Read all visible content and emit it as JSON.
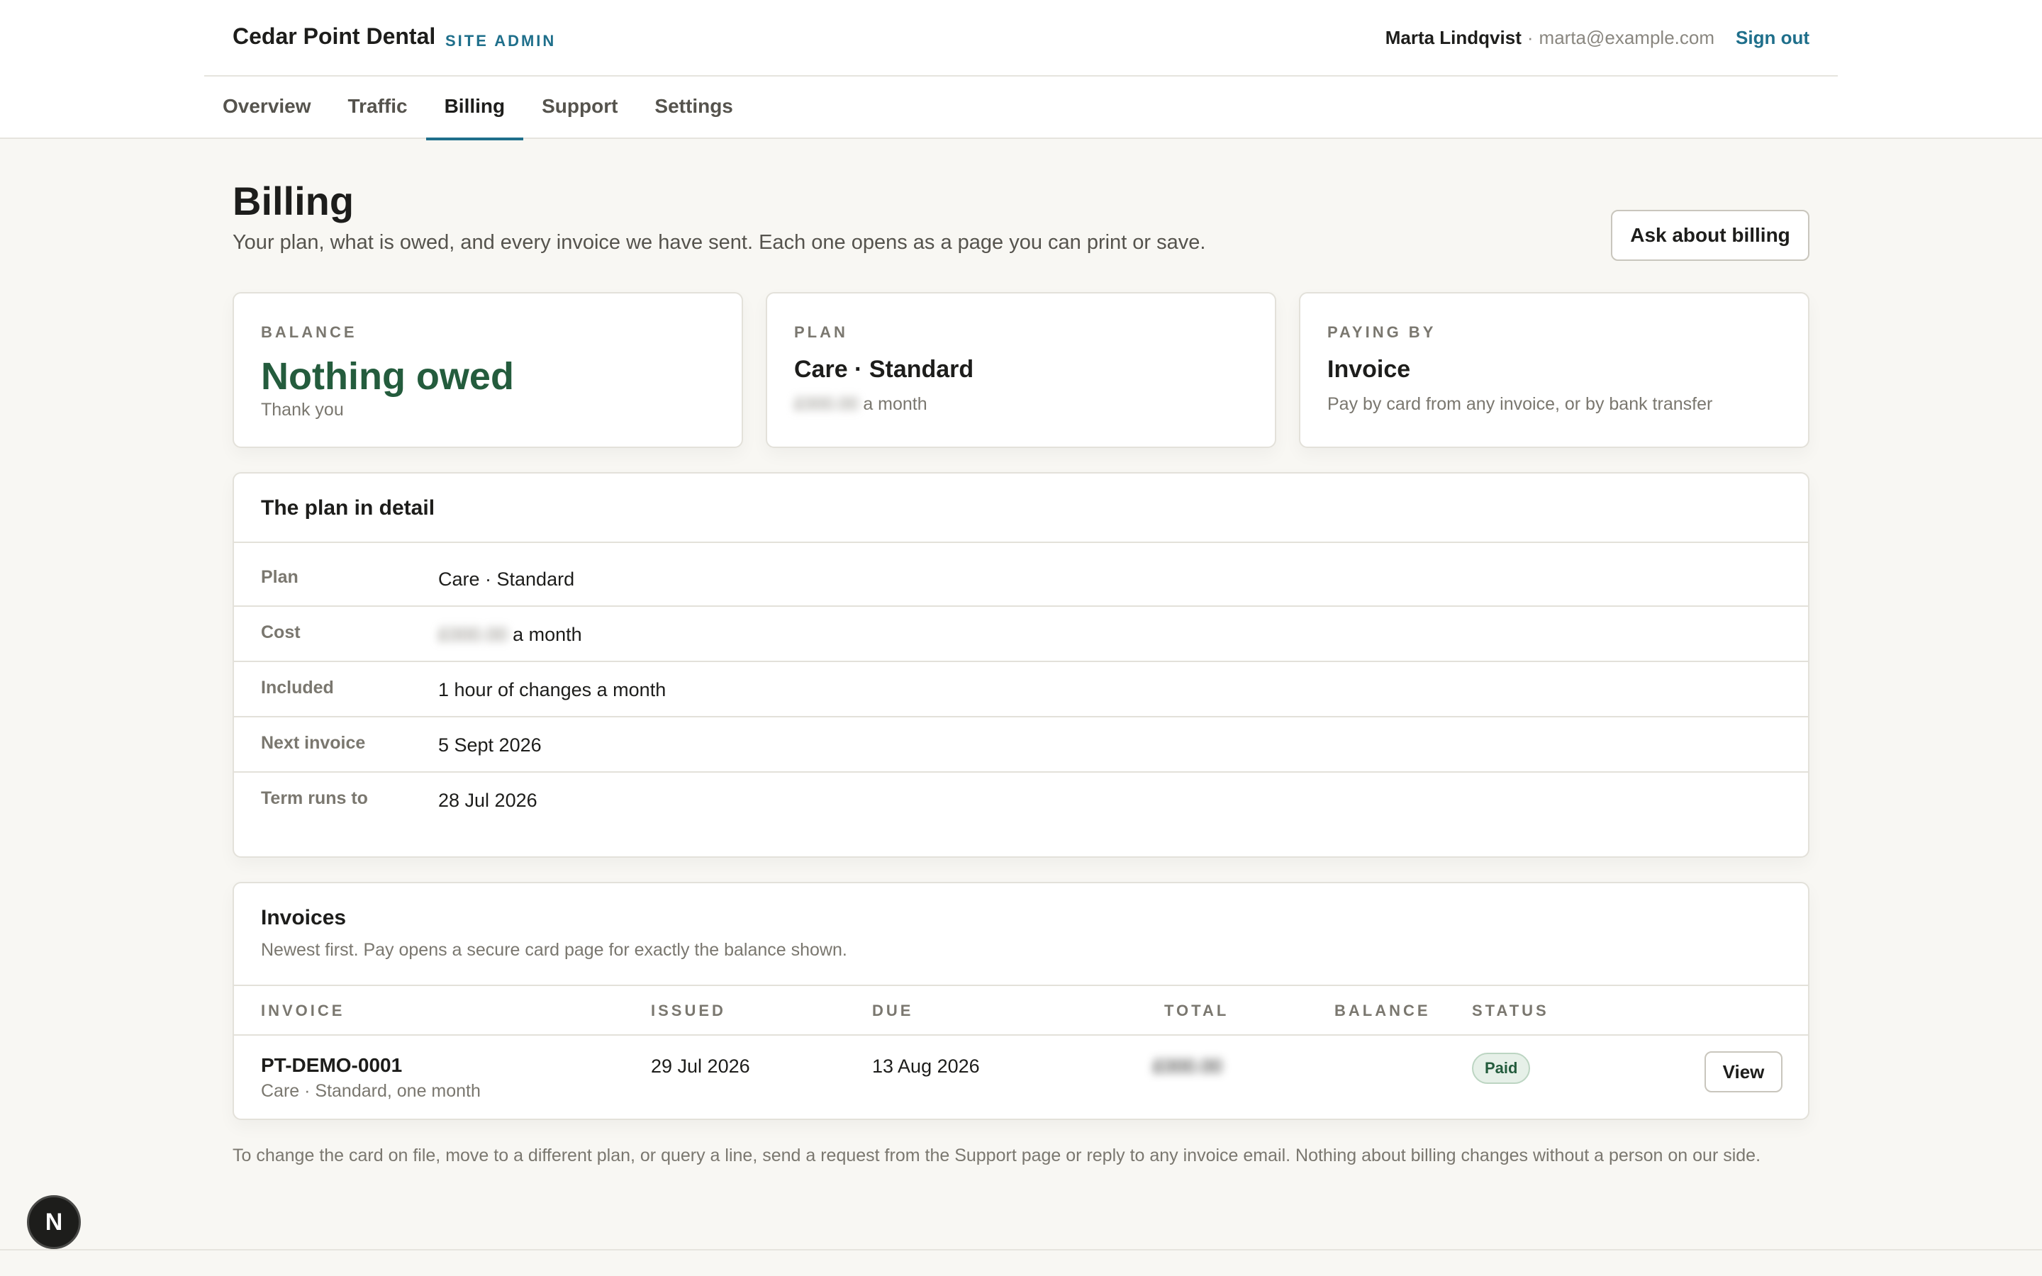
{
  "header": {
    "brand": "Cedar Point Dental",
    "brand_tag": "SITE ADMIN",
    "user_name": "Marta Lindqvist",
    "user_sep": "·",
    "user_email": "marta@example.com",
    "sign_out": "Sign out"
  },
  "tabs": [
    {
      "label": "Overview"
    },
    {
      "label": "Traffic"
    },
    {
      "label": "Billing",
      "active": true
    },
    {
      "label": "Support"
    },
    {
      "label": "Settings"
    }
  ],
  "page": {
    "title": "Billing",
    "subtitle": "Your plan, what is owed, and every invoice we have sent. Each one opens as a page you can print or save.",
    "ask_button": "Ask about billing"
  },
  "summary": {
    "balance": {
      "label": "BALANCE",
      "value": "Nothing owed",
      "note": "Thank you"
    },
    "plan": {
      "label": "PLAN",
      "value": "Care · Standard",
      "amount": "£000.00",
      "period": "a month"
    },
    "paying": {
      "label": "PAYING BY",
      "value": "Invoice",
      "note": "Pay by card from any invoice, or by bank transfer"
    }
  },
  "plan_detail": {
    "title": "The plan in detail",
    "rows": [
      {
        "label": "Plan",
        "value": "Care · Standard"
      },
      {
        "label": "Cost",
        "amount": "£000.00",
        "value": "a month"
      },
      {
        "label": "Included",
        "value": "1 hour of changes a month"
      },
      {
        "label": "Next invoice",
        "value": "5 Sept 2026"
      },
      {
        "label": "Term runs to",
        "value": "28 Jul 2026"
      }
    ]
  },
  "invoices": {
    "title": "Invoices",
    "subtitle": "Newest first. Pay opens a secure card page for exactly the balance shown.",
    "columns": [
      "INVOICE",
      "ISSUED",
      "DUE",
      "TOTAL",
      "BALANCE",
      "STATUS"
    ],
    "rows": [
      {
        "id": "PT-DEMO-0001",
        "desc": "Care · Standard, one month",
        "issued": "29 Jul 2026",
        "due": "13 Aug 2026",
        "total": "£000.00",
        "status": "Paid",
        "action": "View"
      }
    ]
  },
  "footnote": "To change the card on file, move to a different plan, or query a line, send a request from the Support page or reply to any invoice email. Nothing about billing changes without a person on our side.",
  "dev_badge": "N",
  "colors": {
    "accent": "#1f6f8b",
    "positive": "#245c3d",
    "background": "#f8f7f3"
  }
}
